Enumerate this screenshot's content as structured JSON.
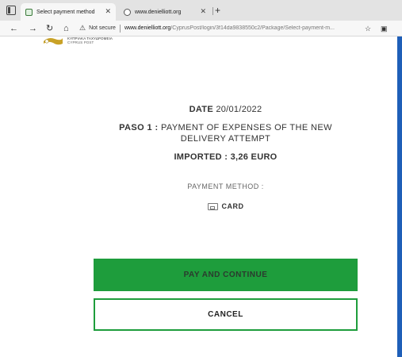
{
  "browser": {
    "tabs": [
      {
        "title": "Select payment method",
        "active": true
      },
      {
        "title": "www.denielliott.org",
        "active": false
      }
    ],
    "address": {
      "security": "Not secure",
      "host": "www.denielliott.org",
      "path": "/CyprusPost/login/3f14da9838550c2/Package/Select-payment-m..."
    }
  },
  "logo": {
    "line1": "ΚΥΠΡΙΑΚΑ ΤΑΧΥΔΡΟΜΕΙΑ",
    "line2": "CYPRUS POST"
  },
  "page": {
    "date_label": "DATE",
    "date_value": "20/01/2022",
    "step_label": "PASO 1 :",
    "step_text": "PAYMENT OF EXPENSES OF THE NEW DELIVERY ATTEMPT",
    "amount_label": "IMPORTED :",
    "amount_value": "3,26 EURO",
    "method_label": "PAYMENT METHOD :",
    "method_option": "CARD",
    "pay_button": "PAY AND CONTINUE",
    "cancel_button": "CANCEL"
  },
  "colors": {
    "accent": "#1e9d3c",
    "desktop": "#1f5fb8"
  }
}
